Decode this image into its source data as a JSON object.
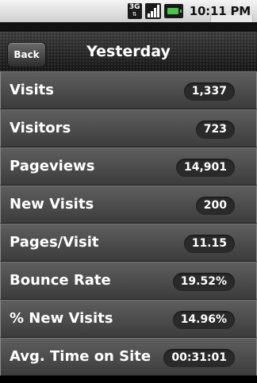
{
  "status_bar": {
    "network_type": "3G",
    "time": "10:11 PM"
  },
  "nav": {
    "back_label": "Back",
    "title": "Yesterday"
  },
  "metrics": [
    {
      "label": "Visits",
      "value": "1,337"
    },
    {
      "label": "Visitors",
      "value": "723"
    },
    {
      "label": "Pageviews",
      "value": "14,901"
    },
    {
      "label": "New Visits",
      "value": "200"
    },
    {
      "label": "Pages/Visit",
      "value": "11.15"
    },
    {
      "label": "Bounce Rate",
      "value": "19.52%"
    },
    {
      "label": "% New Visits",
      "value": "14.96%"
    },
    {
      "label": "Avg. Time on Site",
      "value": "00:31:01"
    }
  ]
}
